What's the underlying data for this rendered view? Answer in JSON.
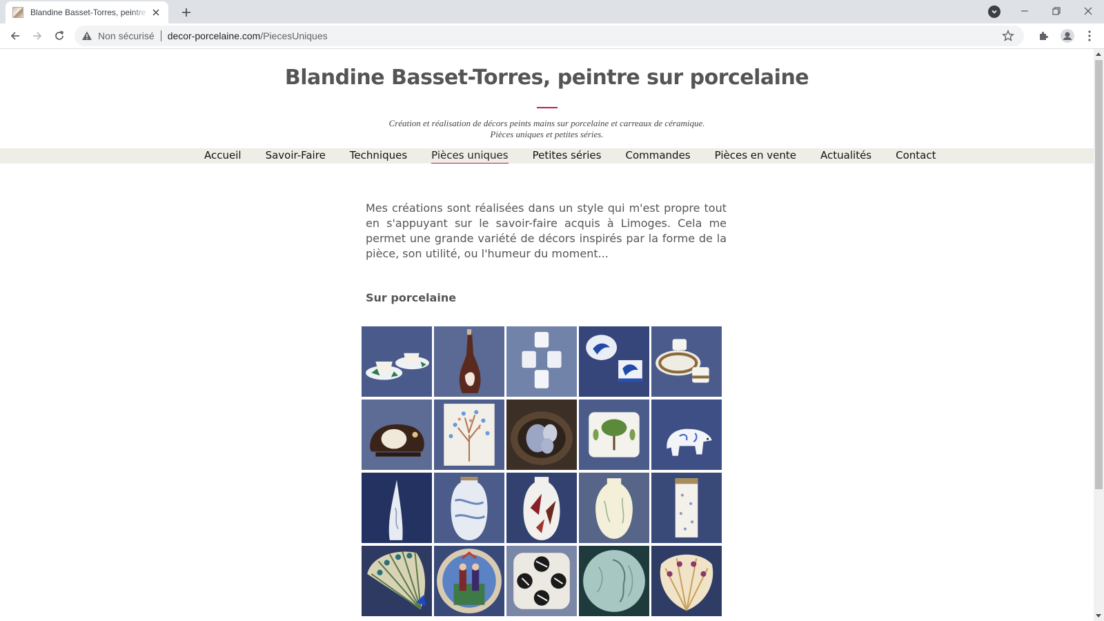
{
  "browser": {
    "tab_title": "Blandine Basset-Torres, peintre sur porcelaine",
    "security_label": "Non sécurisé",
    "url_domain": "decor-porcelaine.com",
    "url_path": "/PiecesUniques"
  },
  "site": {
    "title": "Blandine Basset-Torres, peintre sur porcelaine",
    "tagline_line1": "Création et réalisation de décors peints mains sur porcelaine et carreaux de céramique.",
    "tagline_line2": "Pièces uniques et petites séries.",
    "accent_color": "#c2185b",
    "menu_bg": "#eeede6"
  },
  "menu": [
    {
      "label": "Accueil",
      "active": false
    },
    {
      "label": "Savoir-Faire",
      "active": false
    },
    {
      "label": "Techniques",
      "active": false
    },
    {
      "label": "Pièces uniques",
      "active": true
    },
    {
      "label": "Petites séries",
      "active": false
    },
    {
      "label": "Commandes",
      "active": false
    },
    {
      "label": "Pièces en vente",
      "active": false
    },
    {
      "label": "Actualités",
      "active": false
    },
    {
      "label": "Contact",
      "active": false
    }
  ],
  "main": {
    "intro": "Mes créations sont réalisées dans un style qui m'est propre tout en s'appuyant sur le savoir-faire acquis à Limoges. Cela me permet une grande variété de décors inspirés par la forme de la pièce, son utilité, ou l'humeur du moment...",
    "section_title": "Sur porcelaine"
  },
  "gallery": [
    "teacups-green-triangles",
    "bottle-brown-swirl",
    "stacked-white-cups",
    "blue-bird-boxes",
    "gold-rim-cups",
    "brown-elephant-box",
    "tree-of-life-tile",
    "basket-with-eggs",
    "olive-tree-plate",
    "polar-bear-figurine",
    "tall-thin-vase",
    "blue-gray-vase",
    "red-leaf-vase",
    "cream-ovoid-vase",
    "square-gold-vase",
    "peacock-fan-dish",
    "folk-art-plate",
    "zebra-coasters",
    "face-relief-plate",
    "feather-shell-dish"
  ]
}
